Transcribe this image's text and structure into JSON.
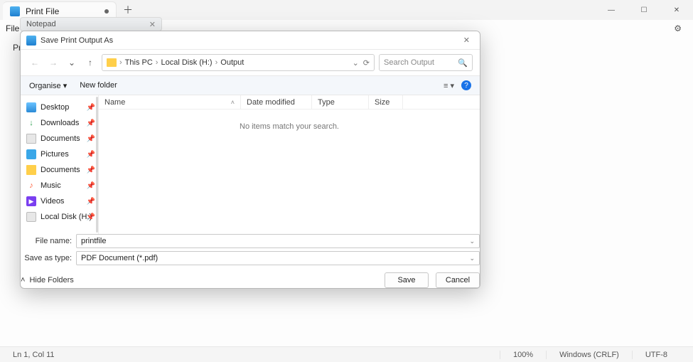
{
  "window": {
    "tab_title": "Print File",
    "modified_dot": true,
    "menu_file": "File"
  },
  "content_hint": "Pri",
  "notepad_tab": "Notepad",
  "status": {
    "cursor": "Ln 1, Col 11",
    "zoom": "100%",
    "line_ending": "Windows (CRLF)",
    "encoding": "UTF-8"
  },
  "dialog": {
    "title": "Save Print Output As",
    "breadcrumbs": [
      "This PC",
      "Local Disk (H:)",
      "Output"
    ],
    "search_placeholder": "Search Output",
    "toolbar": {
      "organise": "Organise",
      "new_folder": "New folder"
    },
    "columns": {
      "name": "Name",
      "date": "Date modified",
      "type": "Type",
      "size": "Size"
    },
    "empty": "No items match your search.",
    "sidebar": [
      {
        "label": "Desktop",
        "icon": "desktop",
        "pin": true
      },
      {
        "label": "Downloads",
        "icon": "down",
        "pin": true
      },
      {
        "label": "Documents",
        "icon": "doc",
        "pin": true
      },
      {
        "label": "Pictures",
        "icon": "pic",
        "pin": true
      },
      {
        "label": "Documents",
        "icon": "folder",
        "pin": true
      },
      {
        "label": "Music",
        "icon": "music",
        "pin": true
      },
      {
        "label": "Videos",
        "icon": "video",
        "pin": true
      },
      {
        "label": "Local Disk (H:)",
        "icon": "disk",
        "pin": true
      }
    ],
    "filename_label": "File name:",
    "filename_value": "printfile",
    "saveas_label": "Save as type:",
    "saveas_value": "PDF Document (*.pdf)",
    "hide_folders": "Hide Folders",
    "save": "Save",
    "cancel": "Cancel"
  }
}
